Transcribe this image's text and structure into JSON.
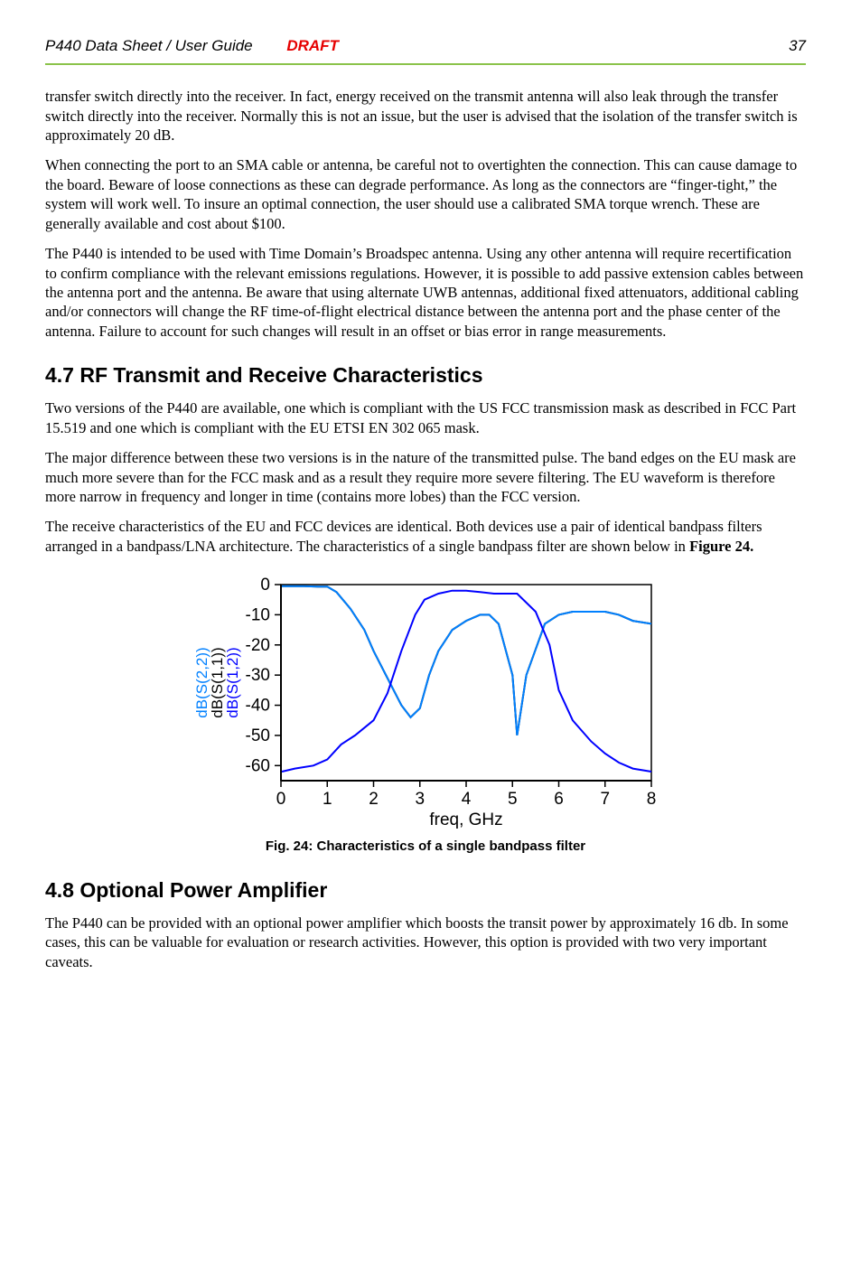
{
  "header": {
    "left": "P440 Data Sheet / User Guide",
    "center": "DRAFT",
    "right": "37"
  },
  "paragraphs": {
    "p1": "transfer switch directly into the receiver.  In fact, energy received on the transmit antenna will also leak through the transfer switch directly into the receiver.  Normally this is not an issue, but the user is advised that the isolation of the transfer switch is approximately 20 dB.",
    "p2": "When connecting the port to an SMA cable or antenna, be careful not to overtighten the connection.  This can cause damage to the board.  Beware of loose connections as these can degrade performance.  As long as the connectors are “finger-tight,” the system will work well.  To insure an optimal connection, the user should use a calibrated SMA torque wrench.  These are generally available and cost about $100.",
    "p3": "The P440 is intended to be used with Time Domain’s Broadspec antenna.  Using any other antenna will require recertification to confirm compliance with the relevant emissions regulations.   However, it is possible to add passive extension cables between the antenna port and the antenna.  Be aware that using alternate UWB antennas, additional fixed attenuators, additional cabling and/or connectors will change the RF time-of-flight electrical distance between the antenna port and the phase center of the antenna.  Failure to account for such changes will result in an offset or bias error in range measurements.",
    "h47": "4.7   RF Transmit and Receive Characteristics",
    "p4": "Two versions of the P440 are available, one which is compliant with the US FCC transmission mask as described in FCC Part 15.519 and one which is compliant with the EU ETSI EN 302 065 mask.",
    "p5": "The major difference between these two versions is in the nature of the transmitted pulse.  The band edges on the EU mask are much more severe than for the FCC mask and as a result they require more severe filtering.  The EU waveform is therefore more narrow in frequency and longer in time (contains more lobes) than the FCC version.",
    "p6a": "The receive characteristics of the EU and FCC devices are identical.  Both devices use a pair of identical bandpass filters arranged in a bandpass/LNA architecture. The characteristics of a single bandpass filter are shown below in ",
    "p6b": "Figure 24.",
    "figcaption": "Fig. 24: Characteristics of a single bandpass filter",
    "h48": "4.8  Optional Power Amplifier",
    "p7": "The P440 can be provided with an optional power amplifier which boosts the transit power by approximately 16 db.  In some cases, this can be valuable for evaluation or research activities.  However, this option is provided with two very important caveats."
  },
  "chart_data": {
    "type": "line",
    "title": "",
    "xlabel": "freq, GHz",
    "ylabel_series": [
      {
        "label": "dB(S(2,2))",
        "color": "#0080ff"
      },
      {
        "label": "dB(S(1,1))",
        "color": "#000000"
      },
      {
        "label": "dB(S(1,2))",
        "color": "#0000ff"
      }
    ],
    "x_ticks": [
      0,
      1,
      2,
      3,
      4,
      5,
      6,
      7,
      8
    ],
    "y_ticks": [
      0,
      -10,
      -20,
      -30,
      -40,
      -50,
      -60
    ],
    "xlim": [
      0,
      8
    ],
    "ylim": [
      -65,
      0
    ],
    "series": [
      {
        "name": "dB(S(1,1))",
        "color": "#000000",
        "x": [
          0.02,
          0.25,
          0.5,
          0.8,
          1.0,
          1.2,
          1.5,
          1.8,
          2.0,
          2.3,
          2.6,
          2.8,
          3.0,
          3.2,
          3.4,
          3.7,
          4.0,
          4.3,
          4.5,
          4.7,
          5.0,
          5.1,
          5.3,
          5.7,
          6.0,
          6.3,
          6.6,
          7.0,
          7.3,
          7.6,
          8.0
        ],
        "values": [
          -0.5,
          -0.5,
          -0.5,
          -0.7,
          -0.7,
          -2.5,
          -8,
          -15,
          -22,
          -31,
          -40,
          -44,
          -41,
          -30,
          -22,
          -15,
          -12,
          -10,
          -10,
          -13,
          -30,
          -50,
          -30,
          -13,
          -10,
          -9,
          -9,
          -9,
          -10,
          -12,
          -13
        ]
      },
      {
        "name": "dB(S(2,2))",
        "color": "#0080ff",
        "x": [
          0.02,
          0.25,
          0.5,
          0.8,
          1.0,
          1.2,
          1.5,
          1.8,
          2.0,
          2.3,
          2.6,
          2.8,
          3.0,
          3.2,
          3.4,
          3.7,
          4.0,
          4.3,
          4.5,
          4.7,
          5.0,
          5.1,
          5.3,
          5.7,
          6.0,
          6.3,
          6.6,
          7.0,
          7.3,
          7.6,
          8.0
        ],
        "values": [
          -0.5,
          -0.5,
          -0.5,
          -0.7,
          -0.7,
          -2.5,
          -8,
          -15,
          -22,
          -31,
          -40,
          -44,
          -41,
          -30,
          -22,
          -15,
          -12,
          -10,
          -10,
          -13,
          -30,
          -50,
          -30,
          -13,
          -10,
          -9,
          -9,
          -9,
          -10,
          -12,
          -13
        ]
      },
      {
        "name": "dB(S(1,2))",
        "color": "#0000ff",
        "x": [
          0.02,
          0.3,
          0.7,
          1.0,
          1.3,
          1.6,
          2.0,
          2.3,
          2.6,
          2.9,
          3.1,
          3.4,
          3.7,
          4.0,
          4.3,
          4.6,
          4.9,
          5.1,
          5.5,
          5.8,
          6.0,
          6.3,
          6.7,
          7.0,
          7.3,
          7.6,
          8.0
        ],
        "values": [
          -62,
          -61,
          -60,
          -58,
          -53,
          -50,
          -45,
          -36,
          -22,
          -10,
          -5,
          -3,
          -2,
          -2,
          -2.5,
          -3,
          -3,
          -3,
          -9,
          -20,
          -35,
          -45,
          -52,
          -56,
          -59,
          -61,
          -62
        ]
      }
    ]
  }
}
